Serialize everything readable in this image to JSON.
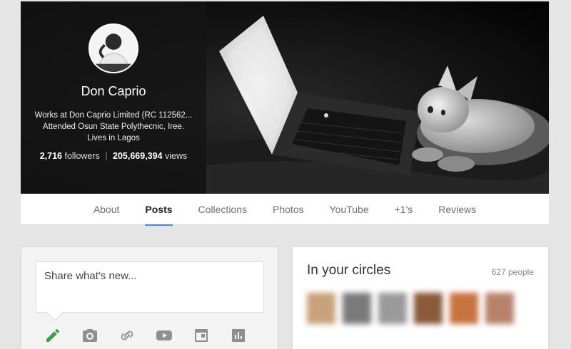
{
  "profile": {
    "name": "Don Caprio",
    "bio_line1": "Works at Don Caprio Limited (RC 112562...",
    "bio_line2": "Attended Osun State Polythecnic, Iree.",
    "bio_line3": "Lives in Lagos",
    "followers_count": "2,716",
    "followers_label": "followers",
    "views_count": "205,669,394",
    "views_label": "views"
  },
  "tabs": [
    {
      "label": "About",
      "active": false
    },
    {
      "label": "Posts",
      "active": true
    },
    {
      "label": "Collections",
      "active": false
    },
    {
      "label": "Photos",
      "active": false
    },
    {
      "label": "YouTube",
      "active": false
    },
    {
      "label": "+1's",
      "active": false
    },
    {
      "label": "Reviews",
      "active": false
    }
  ],
  "share": {
    "placeholder": "Share what's new...",
    "icons": [
      "pencil-icon",
      "camera-icon",
      "link-icon",
      "video-icon",
      "event-icon",
      "poll-icon"
    ]
  },
  "circles": {
    "title": "In your circles",
    "count": "627 people",
    "avatar_colors": [
      "#c9a27c",
      "#7a7a7a",
      "#9a9a9a",
      "#8a5a3a",
      "#c8733f",
      "#b8826a",
      "#c78fa0"
    ]
  },
  "colors": {
    "accent": "#4285f4",
    "pencil": "#3f9e48",
    "icon_gray": "#8f8f8f"
  }
}
